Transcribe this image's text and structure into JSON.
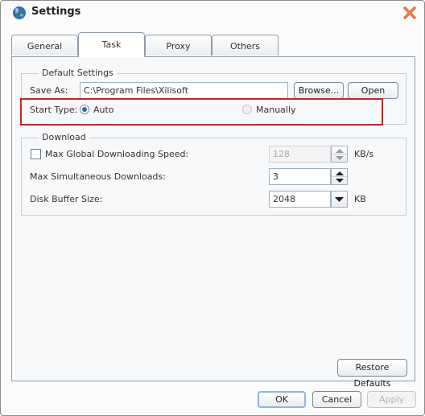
{
  "window": {
    "title": "Settings"
  },
  "tabs": [
    {
      "label": "General"
    },
    {
      "label": "Task"
    },
    {
      "label": "Proxy"
    },
    {
      "label": "Others"
    }
  ],
  "active_tab": "Task",
  "default_settings": {
    "title": "Default Settings",
    "save_as_label": "Save As:",
    "save_as_value": "C:\\Program Files\\Xilisoft",
    "browse_label": "Browse...",
    "open_label": "Open",
    "start_type_label": "Start Type:",
    "auto_label": "Auto",
    "manually_label": "Manually",
    "selected_start_type": "Auto"
  },
  "download": {
    "title": "Download",
    "max_speed_label": "Max Global Downloading Speed:",
    "max_speed_checked": false,
    "max_speed_value": "128",
    "max_speed_unit": "KB/s",
    "max_simultaneous_label": "Max Simultaneous Downloads:",
    "max_simultaneous_value": "3",
    "disk_buffer_label": "Disk Buffer Size:",
    "disk_buffer_value": "2048",
    "disk_buffer_unit": "KB"
  },
  "buttons": {
    "restore_defaults": "Restore Defaults",
    "ok": "OK",
    "cancel": "Cancel",
    "apply": "Apply"
  },
  "colors": {
    "highlight_border": "#b92b2b",
    "selected_radio": "#2b6cb3",
    "close_icon": "#d9551a"
  }
}
